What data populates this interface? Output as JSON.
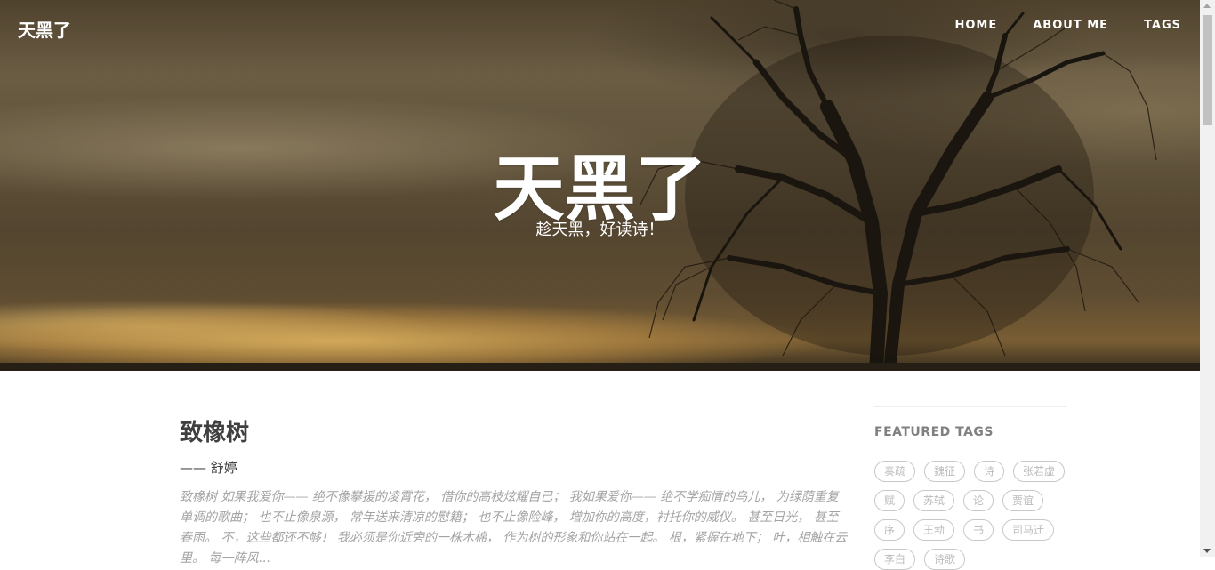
{
  "navbar": {
    "brand": "天黑了",
    "links": [
      "HOME",
      "ABOUT ME",
      "TAGS"
    ]
  },
  "hero": {
    "title": "天黑了",
    "subtitle": "趁天黑，好读诗！"
  },
  "post": {
    "title": "致橡树",
    "author": "—— 舒婷",
    "excerpt": "致橡树 如果我爱你—— 绝不像攀援的凌霄花， 借你的高枝炫耀自己； 我如果爱你—— 绝不学痴情的鸟儿， 为绿荫重复单调的歌曲； 也不止像泉源， 常年送来清凉的慰籍； 也不止像险峰， 增加你的高度，衬托你的威仪。 甚至日光， 甚至春雨。 不，这些都还不够！ 我必须是你近旁的一株木棉， 作为树的形象和你站在一起。 根，紧握在地下； 叶，相触在云里。 每一阵风..."
  },
  "sidebar": {
    "title": "FEATURED TAGS",
    "tags": [
      "奏疏",
      "魏征",
      "诗",
      "张若虚",
      "赋",
      "苏轼",
      "论",
      "贾谊",
      "序",
      "王勃",
      "书",
      "司马迁",
      "李白",
      "诗歌"
    ]
  },
  "colors": {
    "text_dark": "#404040",
    "text_muted": "#a3a3a3",
    "tag_border": "#c8c8c8"
  }
}
